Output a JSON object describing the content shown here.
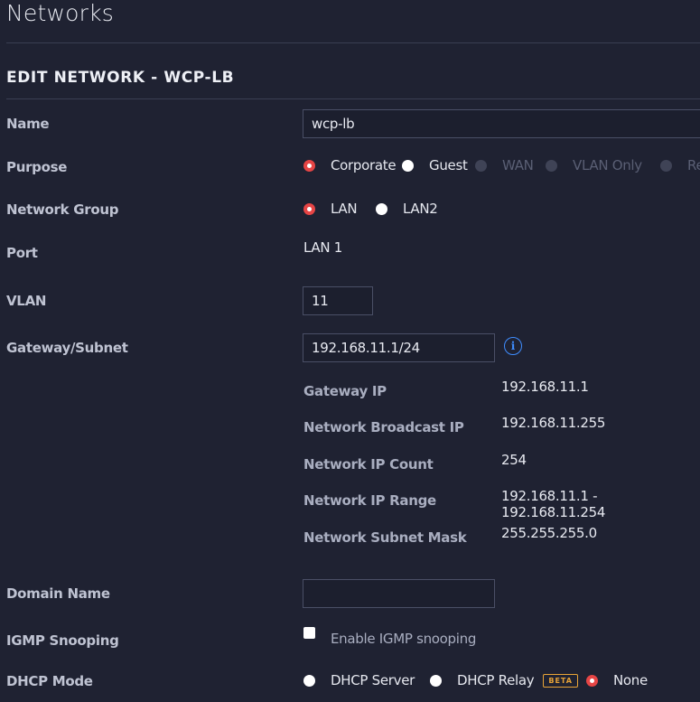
{
  "page": {
    "title": "Networks"
  },
  "section": {
    "title": "EDIT NETWORK - WCP-LB"
  },
  "fields": {
    "name": {
      "label": "Name",
      "value": "wcp-lb"
    },
    "purpose": {
      "label": "Purpose",
      "options": [
        {
          "label": "Corporate",
          "state": "selected"
        },
        {
          "label": "Guest",
          "state": "unselected"
        },
        {
          "label": "WAN",
          "state": "disabled"
        },
        {
          "label": "VLAN Only",
          "state": "disabled"
        },
        {
          "label": "Re",
          "state": "disabled"
        }
      ]
    },
    "network_group": {
      "label": "Network Group",
      "options": [
        {
          "label": "LAN",
          "state": "selected"
        },
        {
          "label": "LAN2",
          "state": "unselected"
        }
      ]
    },
    "port": {
      "label": "Port",
      "value": "LAN 1"
    },
    "vlan": {
      "label": "VLAN",
      "value": "11"
    },
    "gateway_subnet": {
      "label": "Gateway/Subnet",
      "value": "192.168.11.1/24",
      "info_icon": "info-icon"
    },
    "subnet_info": [
      {
        "label": "Gateway IP",
        "value": "192.168.11.1"
      },
      {
        "label": "Network Broadcast IP",
        "value": "192.168.11.255"
      },
      {
        "label": "Network IP Count",
        "value": "254"
      },
      {
        "label": "Network IP Range",
        "value": "192.168.11.1 - 192.168.11.254"
      },
      {
        "label": "Network Subnet Mask",
        "value": "255.255.255.0"
      }
    ],
    "domain_name": {
      "label": "Domain Name",
      "value": ""
    },
    "igmp_snooping": {
      "label": "IGMP Snooping",
      "checkbox_label": "Enable IGMP snooping",
      "checked": false
    },
    "dhcp_mode": {
      "label": "DHCP Mode",
      "options": [
        {
          "label": "DHCP Server",
          "state": "unselected"
        },
        {
          "label": "DHCP Relay",
          "state": "unselected",
          "badge": "BETA"
        },
        {
          "label": "None",
          "state": "selected"
        }
      ]
    }
  },
  "colors": {
    "background": "#1f2232",
    "radio_selected": "#e64545",
    "info": "#3f8dff",
    "beta_badge": "#e8a437"
  }
}
